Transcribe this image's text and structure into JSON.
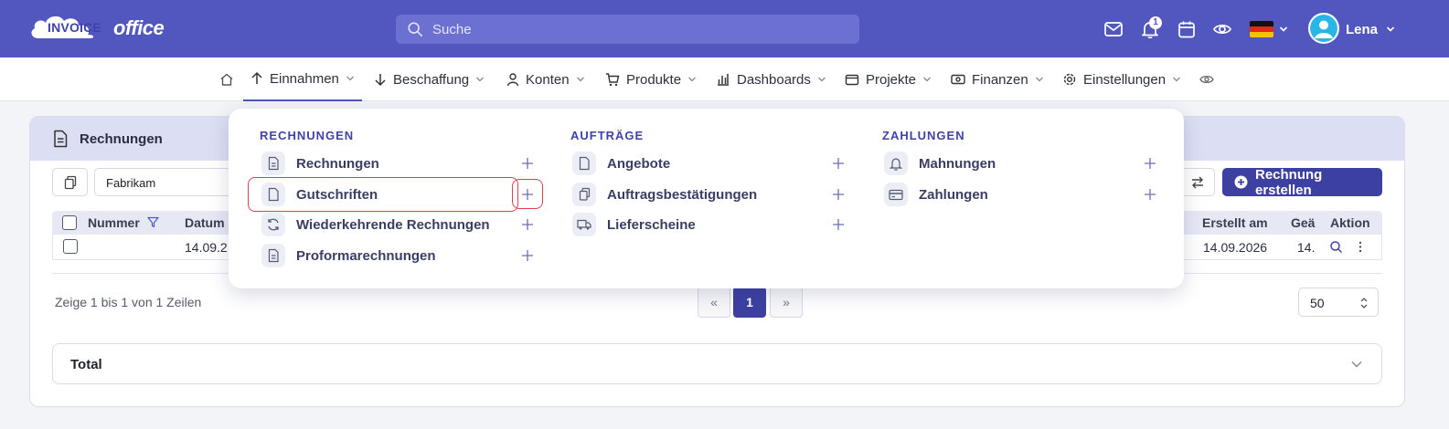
{
  "header": {
    "logo_text_1": "INVOICE",
    "logo_text_2": "office",
    "search_placeholder": "Suche",
    "notifications_count": "1",
    "username": "Lena",
    "language_flag": "de"
  },
  "nav": {
    "items": [
      {
        "label": "Einnahmen",
        "icon": "arrow-up-icon"
      },
      {
        "label": "Beschaffung",
        "icon": "arrow-down-icon"
      },
      {
        "label": "Konten",
        "icon": "user-icon"
      },
      {
        "label": "Produkte",
        "icon": "cart-icon"
      },
      {
        "label": "Dashboards",
        "icon": "bar-chart-icon"
      },
      {
        "label": "Projekte",
        "icon": "folder-icon"
      },
      {
        "label": "Finanzen",
        "icon": "cash-icon"
      },
      {
        "label": "Einstellungen",
        "icon": "gear-icon"
      }
    ]
  },
  "card": {
    "title": "Rechnungen",
    "filter_value": "Fabrikam",
    "create_button": "Rechnung erstellen",
    "columns": {
      "nummer": "Nummer",
      "datum": "Datum",
      "erstellt": "Erstellt am",
      "geaendert": "Geä",
      "aktion": "Aktion"
    },
    "row": {
      "datum": "14.09.2",
      "erstellt": "14.09.2026",
      "geaendert": "14."
    },
    "row_info": "Zeige 1 bis 1 von 1 Zeilen",
    "pagination": {
      "prev": "«",
      "current": "1",
      "next": "»"
    },
    "page_size": "50",
    "total_label": "Total"
  },
  "mega_menu": {
    "columns": [
      {
        "title": "RECHNUNGEN",
        "items": [
          {
            "label": "Rechnungen",
            "icon": "document-icon"
          },
          {
            "label": "Gutschriften",
            "icon": "document-blank-icon"
          },
          {
            "label": "Wiederkehrende Rechnungen",
            "icon": "refresh-icon"
          },
          {
            "label": "Proformarechnungen",
            "icon": "document-icon"
          }
        ]
      },
      {
        "title": "AUFTRÄGE",
        "items": [
          {
            "label": "Angebote",
            "icon": "document-blank-icon"
          },
          {
            "label": "Auftragsbestätigungen",
            "icon": "copy-icon"
          },
          {
            "label": "Lieferscheine",
            "icon": "truck-icon"
          }
        ]
      },
      {
        "title": "ZAHLUNGEN",
        "items": [
          {
            "label": "Mahnungen",
            "icon": "bell-icon"
          },
          {
            "label": "Zahlungen",
            "icon": "credit-card-icon"
          }
        ]
      }
    ]
  },
  "colors": {
    "brand": "#5257bf",
    "primary_button": "#3c40a0",
    "highlight": "#e0404e"
  }
}
